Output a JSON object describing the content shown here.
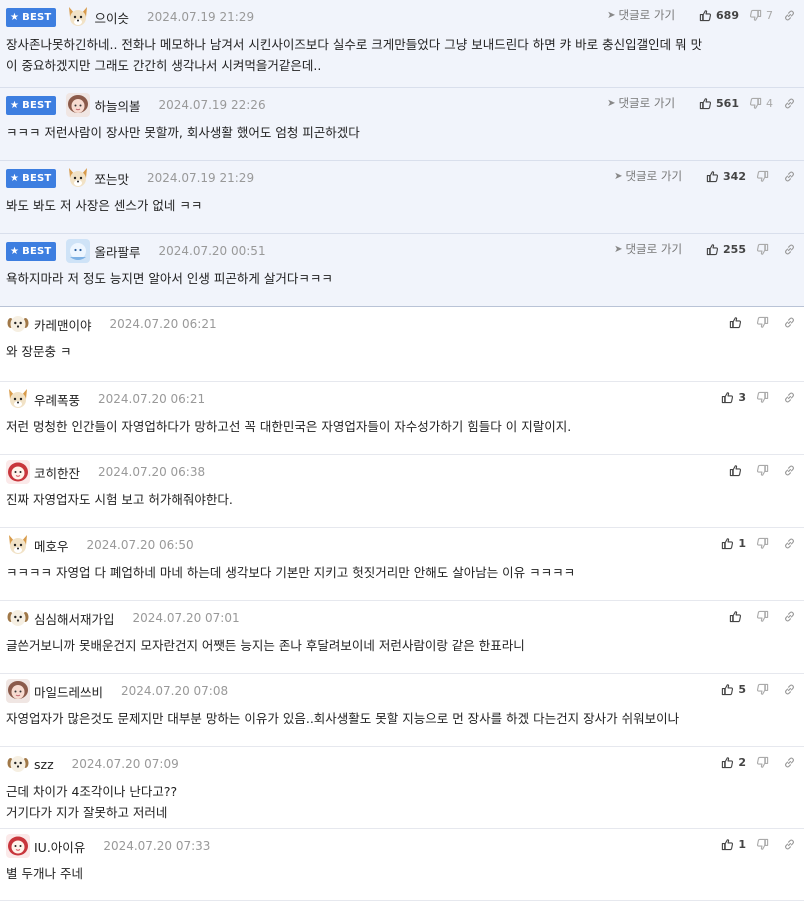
{
  "best_label": "BEST",
  "reply_label": "댓글로 가기",
  "comments": [
    {
      "best": true,
      "avatar": "dog",
      "nickname": "으이슷",
      "date": "2024.07.19 21:29",
      "likes": "689",
      "dislikes": "7",
      "text": [
        "장사존나못하긴하네.. 전화나 메모하나 남겨서 시킨사이즈보다 실수로 크게만들었다 그냥 보내드린다 하면 캬 바로 충신입갤인데 뭐 맛",
        "이 중요하겠지만 그래도 간간히 생각나서 시켜먹을거같은데.."
      ]
    },
    {
      "best": true,
      "avatar": "girl",
      "nickname": "하늘의볼",
      "date": "2024.07.19 22:26",
      "likes": "561",
      "dislikes": "4",
      "text": [
        "ㅋㅋㅋ 저런사람이 장사만 못할까, 회사생활 했어도 엄청 피곤하겠다"
      ]
    },
    {
      "best": true,
      "avatar": "dog",
      "nickname": "쪼는맛",
      "date": "2024.07.19 21:29",
      "likes": "342",
      "dislikes": "",
      "text": [
        "봐도 봐도 저 사장은 센스가 없네 ㅋㅋ"
      ]
    },
    {
      "best": true,
      "avatar": "blue",
      "nickname": "올라팔루",
      "date": "2024.07.20 00:51",
      "likes": "255",
      "dislikes": "",
      "text": [
        "욕하지마라 저 정도 능지면 알아서 인생 피곤하게 살거다ㅋㅋㅋ"
      ]
    },
    {
      "best": false,
      "avatar": "puppy",
      "nickname": "카레맨이야",
      "date": "2024.07.20 06:21",
      "likes": "",
      "dislikes": "",
      "text": [
        "와 장문충 ㅋ"
      ]
    },
    {
      "best": false,
      "avatar": "dog",
      "nickname": "우례폭풍",
      "date": "2024.07.20 06:21",
      "likes": "3",
      "dislikes": "",
      "text": [
        "저런 멍청한 인간들이 자영업하다가 망하고선 꼭 대한민국은 자영업자들이 자수성가하기 힘들다 이 지랄이지."
      ]
    },
    {
      "best": false,
      "avatar": "red",
      "nickname": "코히한잔",
      "date": "2024.07.20 06:38",
      "likes": "",
      "dislikes": "",
      "text": [
        "진짜 자영업자도 시험 보고 허가해줘야한다."
      ]
    },
    {
      "best": false,
      "avatar": "dog",
      "nickname": "메호우",
      "date": "2024.07.20 06:50",
      "likes": "1",
      "dislikes": "",
      "text": [
        "ㅋㅋㅋㅋ 자영업 다 폐업하네 마네 하는데 생각보다 기본만 지키고 헛짓거리만 안해도 살아남는 이유 ㅋㅋㅋㅋ"
      ]
    },
    {
      "best": false,
      "avatar": "puppy",
      "nickname": "심심해서재가입",
      "date": "2024.07.20 07:01",
      "likes": "",
      "dislikes": "",
      "text": [
        "글쓴거보니까 못배운건지 모자란건지 어쨋든 능지는 존나 후달려보이네 저런사람이랑 같은 한표라니"
      ]
    },
    {
      "best": false,
      "avatar": "girl",
      "nickname": "마일드레쓰비",
      "date": "2024.07.20 07:08",
      "likes": "5",
      "dislikes": "",
      "text": [
        "자영업자가 많은것도 문제지만 대부분 망하는 이유가 있음..회사생활도 못할 지능으로 먼 장사를 하겠 다는건지 장사가 쉬워보이나"
      ]
    },
    {
      "best": false,
      "avatar": "puppy",
      "nickname": "szz",
      "date": "2024.07.20 07:09",
      "likes": "2",
      "dislikes": "",
      "text": [
        "근데 차이가 4조각이나 난다고??",
        "거기다가 지가 잘못하고 저러네"
      ]
    },
    {
      "best": false,
      "avatar": "red",
      "nickname": "IU.아이유",
      "date": "2024.07.20 07:33",
      "likes": "1",
      "dislikes": "",
      "text": [
        "별 두개나 주네"
      ]
    }
  ]
}
